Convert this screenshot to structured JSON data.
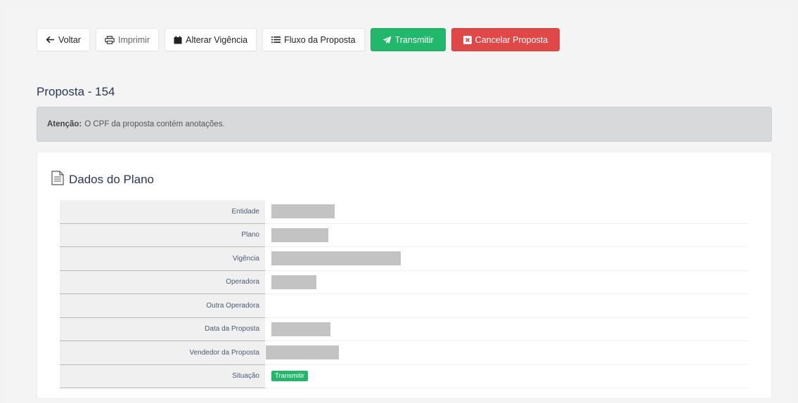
{
  "toolbar": {
    "voltar": "Voltar",
    "imprimir": "Imprimir",
    "alterar_vigencia": "Alterar Vigência",
    "fluxo": "Fluxo da Proposta",
    "transmitir": "Transmitir",
    "cancelar": "Cancelar Proposta"
  },
  "page": {
    "title": "Proposta - 154"
  },
  "alert": {
    "strong": "Atenção:",
    "text": "O CPF da proposta contém anotações."
  },
  "card": {
    "title": "Dados do Plano",
    "rows": [
      {
        "label": "Entidade"
      },
      {
        "label": "Plano"
      },
      {
        "label": "Vigência"
      },
      {
        "label": "Operadora"
      },
      {
        "label": "Outra Operadora"
      },
      {
        "label": "Data da Proposta"
      },
      {
        "label": "Vendedor da Proposta"
      },
      {
        "label": "Situação",
        "badge": "Transmitir"
      }
    ]
  },
  "colors": {
    "success": "#21b86b",
    "danger": "#e04848",
    "heading": "#2b3553"
  },
  "icons": {
    "voltar": "arrow-left-icon",
    "imprimir": "print-icon",
    "alterar_vigencia": "calendar-icon",
    "fluxo": "list-icon",
    "transmitir": "send-icon",
    "cancelar": "close-square-icon",
    "card": "document-icon"
  }
}
